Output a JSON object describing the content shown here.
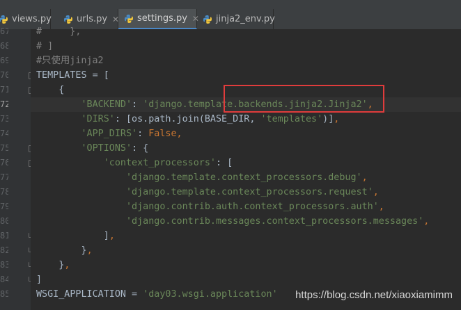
{
  "tabs": [
    {
      "label": "views.py",
      "active": false
    },
    {
      "label": "urls.py",
      "active": false
    },
    {
      "label": "settings.py",
      "active": true
    },
    {
      "label": "jinja2_env.py",
      "active": false
    }
  ],
  "line_numbers": [
    "67",
    "68",
    "69",
    "70",
    "71",
    "72",
    "73",
    "74",
    "75",
    "76",
    "77",
    "78",
    "79",
    "80",
    "81",
    "82",
    "83",
    "84",
    "85"
  ],
  "code_lines": [
    [
      {
        "t": "comment",
        "v": "#     },"
      }
    ],
    [
      {
        "t": "comment",
        "v": "# ]"
      }
    ],
    [
      {
        "t": "comment",
        "v": "#只使用jinja2"
      }
    ],
    [
      {
        "t": "plain",
        "v": "TEMPLATES = ["
      }
    ],
    [
      {
        "t": "plain",
        "v": "    {"
      }
    ],
    [
      {
        "t": "plain",
        "v": "        "
      },
      {
        "t": "string",
        "v": "'BACKEND'"
      },
      {
        "t": "plain",
        "v": ": "
      },
      {
        "t": "string",
        "v": "'django.template.backends.jinja2.Jinja2'"
      },
      {
        "t": "kw",
        "v": ","
      }
    ],
    [
      {
        "t": "plain",
        "v": "        "
      },
      {
        "t": "string",
        "v": "'DIRS'"
      },
      {
        "t": "plain",
        "v": ": [os.path.join(BASE_DIR, "
      },
      {
        "t": "string",
        "v": "'templates'"
      },
      {
        "t": "plain",
        "v": ")]"
      },
      {
        "t": "kw",
        "v": ","
      }
    ],
    [
      {
        "t": "plain",
        "v": "        "
      },
      {
        "t": "string",
        "v": "'APP_DIRS'"
      },
      {
        "t": "plain",
        "v": ": "
      },
      {
        "t": "kw",
        "v": "False,"
      }
    ],
    [
      {
        "t": "plain",
        "v": "        "
      },
      {
        "t": "string",
        "v": "'OPTIONS'"
      },
      {
        "t": "plain",
        "v": ": {"
      }
    ],
    [
      {
        "t": "plain",
        "v": "            "
      },
      {
        "t": "string",
        "v": "'context_processors'"
      },
      {
        "t": "plain",
        "v": ": ["
      }
    ],
    [
      {
        "t": "plain",
        "v": "                "
      },
      {
        "t": "string",
        "v": "'django.template.context_processors.debug'"
      },
      {
        "t": "kw",
        "v": ","
      }
    ],
    [
      {
        "t": "plain",
        "v": "                "
      },
      {
        "t": "string",
        "v": "'django.template.context_processors.request'"
      },
      {
        "t": "kw",
        "v": ","
      }
    ],
    [
      {
        "t": "plain",
        "v": "                "
      },
      {
        "t": "string",
        "v": "'django.contrib.auth.context_processors.auth'"
      },
      {
        "t": "kw",
        "v": ","
      }
    ],
    [
      {
        "t": "plain",
        "v": "                "
      },
      {
        "t": "string",
        "v": "'django.contrib.messages.context_processors.messages'"
      },
      {
        "t": "kw",
        "v": ","
      }
    ],
    [
      {
        "t": "plain",
        "v": "            ]"
      },
      {
        "t": "kw",
        "v": ","
      }
    ],
    [
      {
        "t": "plain",
        "v": "        }"
      },
      {
        "t": "kw",
        "v": ","
      }
    ],
    [
      {
        "t": "plain",
        "v": "    }"
      },
      {
        "t": "kw",
        "v": ","
      }
    ],
    [
      {
        "t": "plain",
        "v": "]"
      }
    ],
    [
      {
        "t": "plain",
        "v": "WSGI_APPLICATION = "
      },
      {
        "t": "string",
        "v": "'day03.wsgi.application'"
      }
    ]
  ],
  "current_line": "72",
  "watermark": "https://blog.csdn.net/xiaoxiamimm",
  "colors": {
    "string": "#6a8759",
    "keyword": "#cc7832",
    "comment": "#808080",
    "highlight_box": "#e03c3c"
  }
}
